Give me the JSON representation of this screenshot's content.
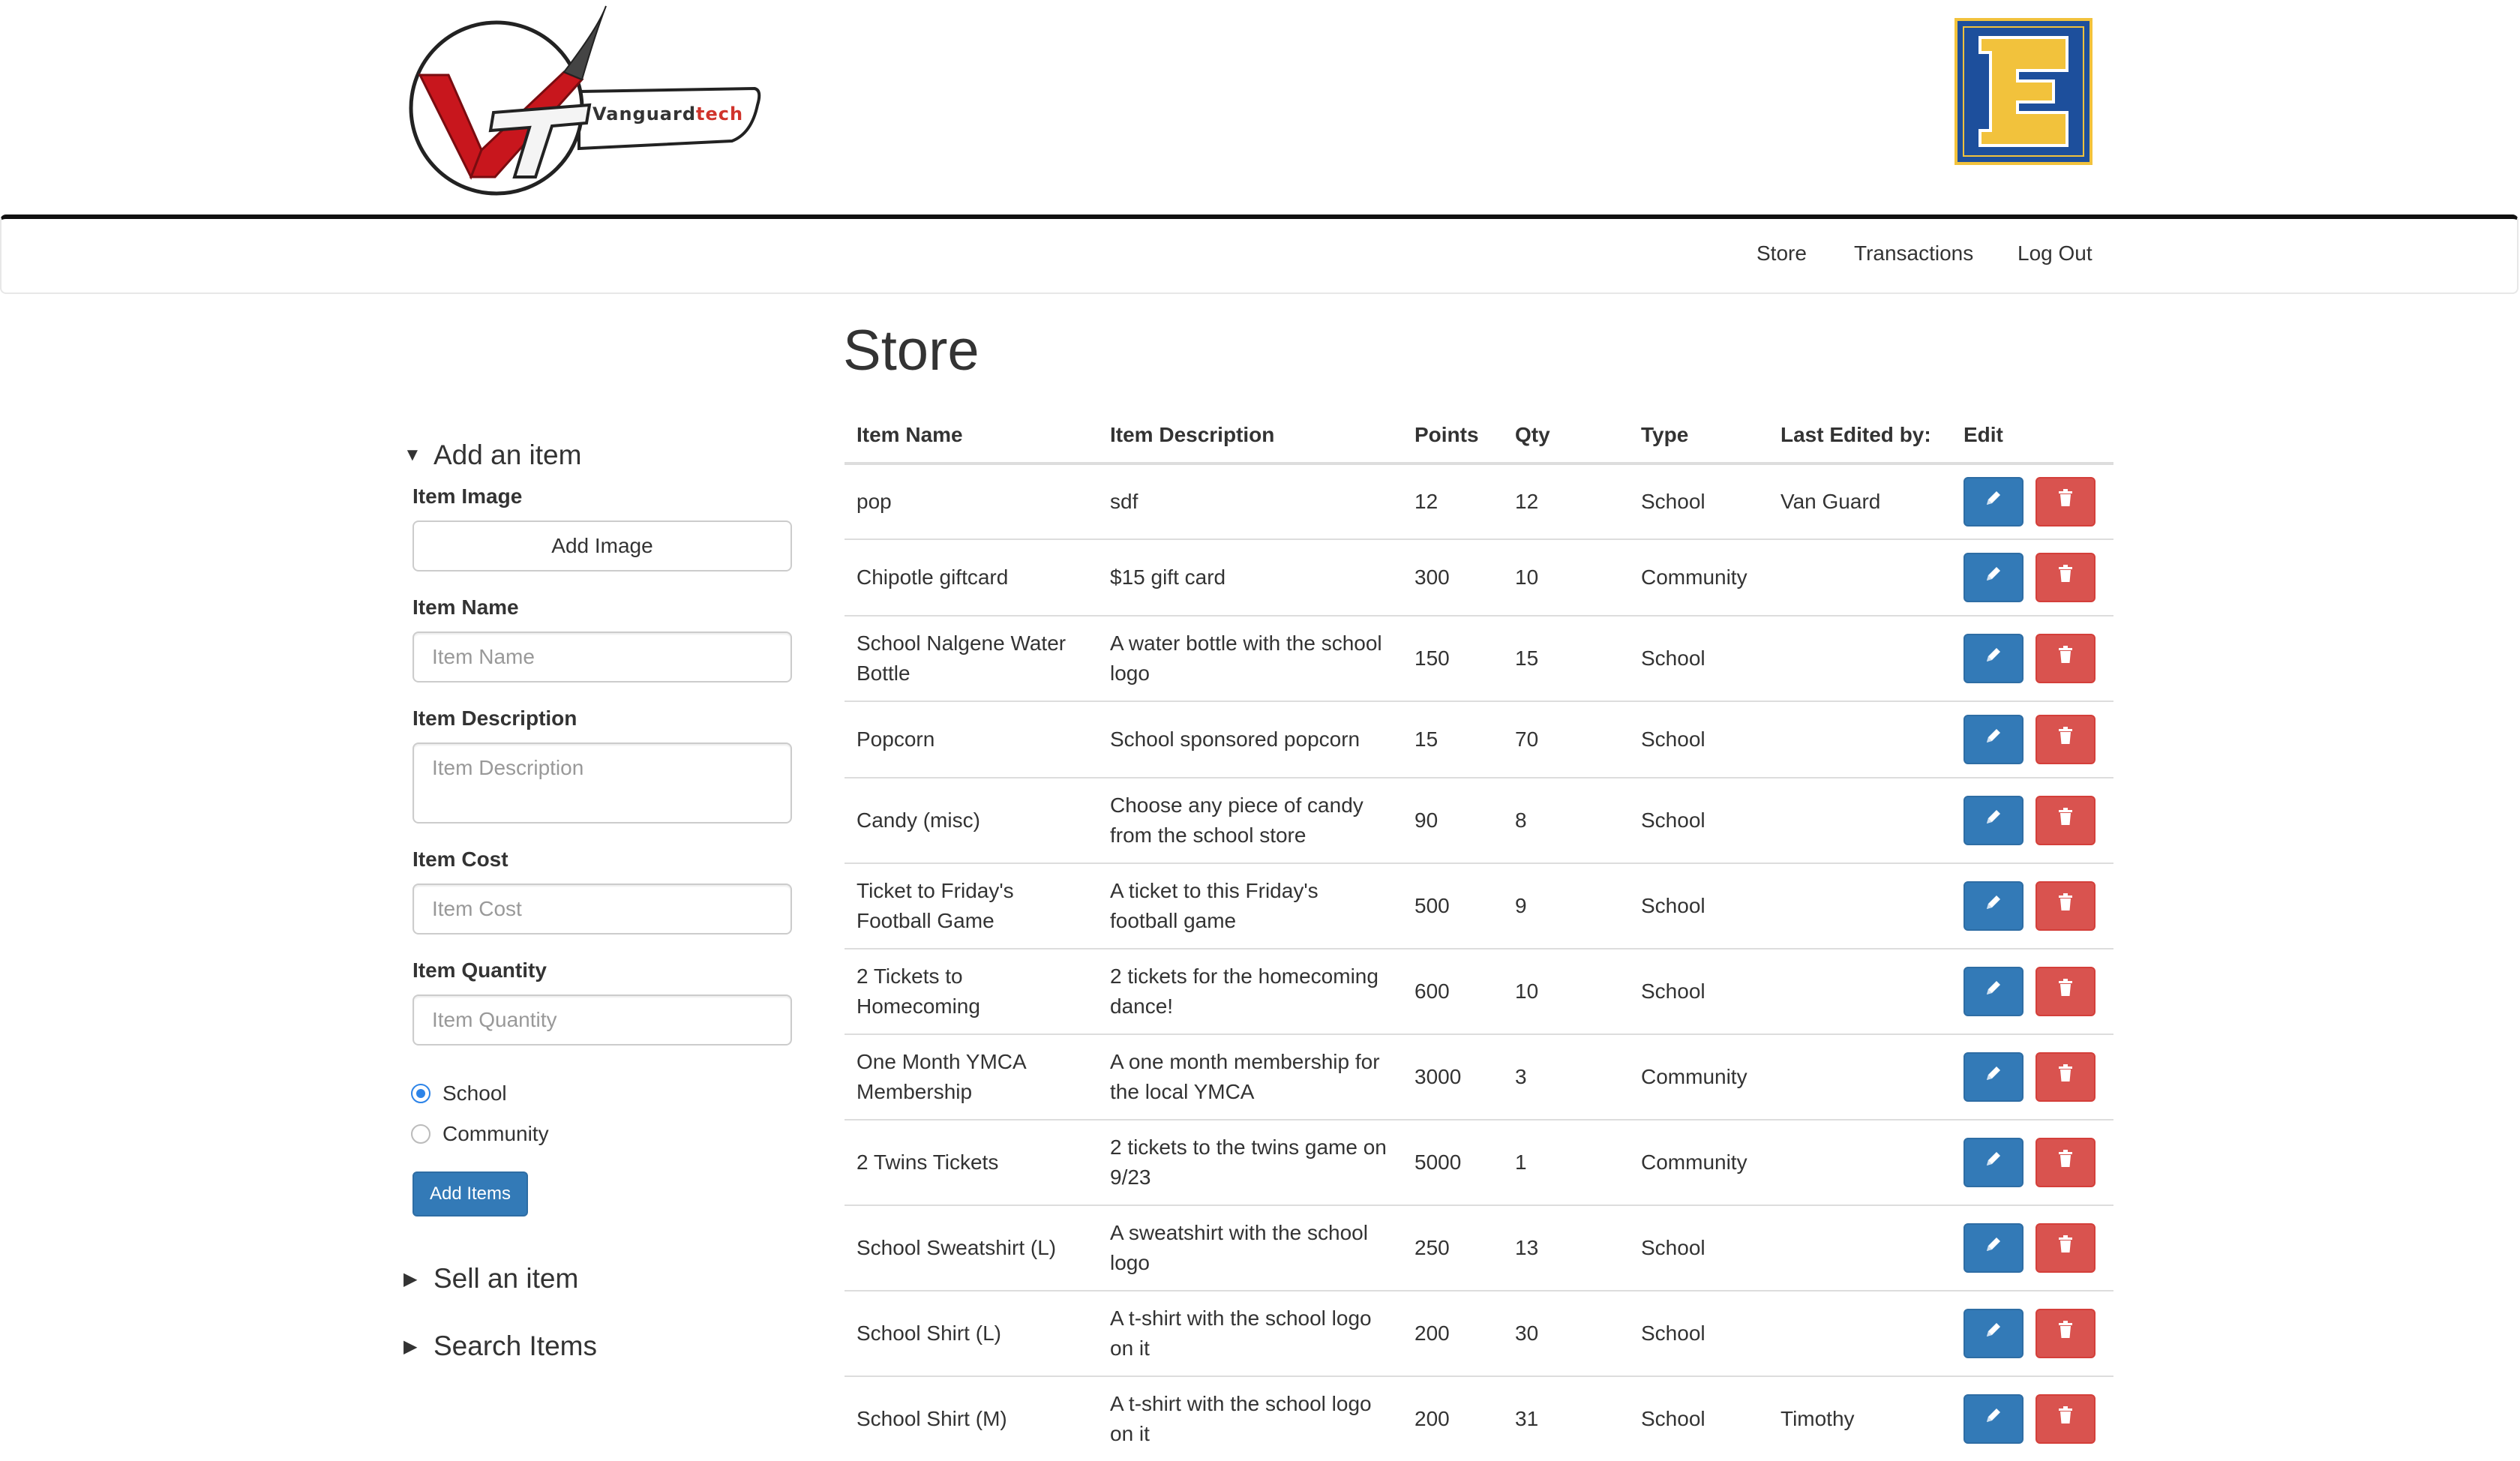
{
  "header": {
    "vt_logo_word_1": "Vanguard",
    "vt_logo_word_2": "tech",
    "school_logo_letter": "E"
  },
  "navbar": {
    "items": [
      "Store",
      "Transactions",
      "Log Out"
    ]
  },
  "page": {
    "title": "Store"
  },
  "sidebar": {
    "add_section": {
      "title": "Add an item",
      "expanded_marker": "▼",
      "image_label": "Item Image",
      "add_image_button": "Add Image",
      "name_label": "Item Name",
      "name_placeholder": "Item Name",
      "description_label": "Item Description",
      "description_placeholder": "Item Description",
      "cost_label": "Item Cost",
      "cost_placeholder": "Item Cost",
      "quantity_label": "Item Quantity",
      "quantity_placeholder": "Item Quantity",
      "radio_school": "School",
      "radio_community": "Community",
      "selected_type": "School",
      "submit_button": "Add Items"
    },
    "sell_section": {
      "title": "Sell an item",
      "collapsed_marker": "▶"
    },
    "search_section": {
      "title": "Search Items",
      "collapsed_marker": "▶"
    }
  },
  "table": {
    "columns": [
      "Item Name",
      "Item Description",
      "Points",
      "Qty",
      "Type",
      "Last Edited by:",
      "Edit"
    ],
    "rows": [
      {
        "name": "pop",
        "description": "sdf",
        "points": "12",
        "qty": "12",
        "type": "School",
        "last_edited": "Van Guard"
      },
      {
        "name": "Chipotle giftcard",
        "description": "$15 gift card",
        "points": "300",
        "qty": "10",
        "type": "Community",
        "last_edited": ""
      },
      {
        "name": "School Nalgene Water Bottle",
        "description": "A water bottle with the school logo",
        "points": "150",
        "qty": "15",
        "type": "School",
        "last_edited": ""
      },
      {
        "name": "Popcorn",
        "description": "School sponsored popcorn",
        "points": "15",
        "qty": "70",
        "type": "School",
        "last_edited": ""
      },
      {
        "name": "Candy (misc)",
        "description": "Choose any piece of candy from the school store",
        "points": "90",
        "qty": "8",
        "type": "School",
        "last_edited": ""
      },
      {
        "name": "Ticket to Friday's Football Game",
        "description": "A ticket to this Friday's football game",
        "points": "500",
        "qty": "9",
        "type": "School",
        "last_edited": ""
      },
      {
        "name": "2 Tickets to Homecoming",
        "description": "2 tickets for the homecoming dance!",
        "points": "600",
        "qty": "10",
        "type": "School",
        "last_edited": ""
      },
      {
        "name": "One Month YMCA Membership",
        "description": "A one month membership for the local YMCA",
        "points": "3000",
        "qty": "3",
        "type": "Community",
        "last_edited": ""
      },
      {
        "name": "2 Twins Tickets",
        "description": "2 tickets to the twins game on 9/23",
        "points": "5000",
        "qty": "1",
        "type": "Community",
        "last_edited": ""
      },
      {
        "name": "School Sweatshirt (L)",
        "description": "A sweatshirt with the school logo",
        "points": "250",
        "qty": "13",
        "type": "School",
        "last_edited": ""
      },
      {
        "name": "School Shirt (L)",
        "description": "A t-shirt with the school logo on it",
        "points": "200",
        "qty": "30",
        "type": "School",
        "last_edited": ""
      },
      {
        "name": "School Shirt (M)",
        "description": "A t-shirt with the school logo on it",
        "points": "200",
        "qty": "31",
        "type": "School",
        "last_edited": "Timothy"
      }
    ]
  },
  "icons": {
    "edit": "pencil-icon",
    "delete": "trash-icon"
  },
  "colors": {
    "primary": "#337ab7",
    "danger": "#d9534f",
    "radio_selected": "#2d84e8",
    "school_logo_blue": "#1d4f9c",
    "school_logo_gold": "#f2c23c",
    "vt_red": "#c8161d"
  }
}
